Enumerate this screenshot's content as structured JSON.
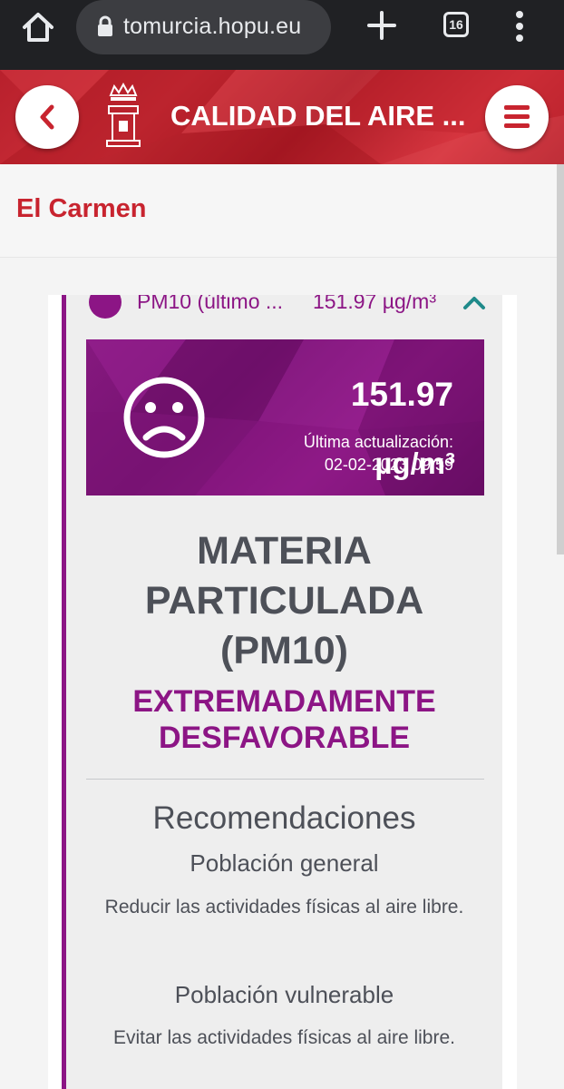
{
  "browser": {
    "url": "tomurcia.hopu.eu",
    "tab_count": "16"
  },
  "header": {
    "title": "CALIDAD DEL AIRE ..."
  },
  "location": {
    "title": "El Carmen"
  },
  "pollutant": {
    "name": "PM10 (último ...",
    "value_summary": "151.97 µg/m³",
    "value": "151.97",
    "unit": "µg/m³",
    "last_update_label": "Última actualización:",
    "last_update_date": "02-02-2023 09:59",
    "full_name_lines": [
      "MATERIA",
      "PARTICULADA",
      "(PM10)"
    ],
    "quality_lines": [
      "EXTREMADAMENTE",
      "DESFAVORABLE"
    ]
  },
  "recommendations": {
    "title": "Recomendaciones",
    "general_label": "Población general",
    "general_text": "Reducir las actividades físicas al aire libre.",
    "vulnerable_label": "Población vulnerable",
    "vulnerable_text": "Evitar las actividades físicas al aire libre."
  },
  "colors": {
    "header_red": "#c8242f",
    "pollutant_purple": "#8c1585",
    "text_gray": "#4d5058"
  }
}
